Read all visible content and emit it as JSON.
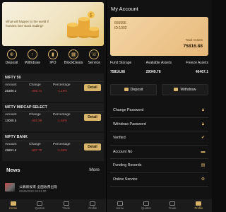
{
  "left": {
    "banner": {
      "text": "What will happen to the world if humans lose stock trading?"
    },
    "quick_links": [
      {
        "label": "Deposit",
        "icon": "deposit-icon"
      },
      {
        "label": "Withdraw",
        "icon": "withdraw-icon"
      },
      {
        "label": "IPO",
        "icon": "ipo-icon"
      },
      {
        "label": "BlockDeals",
        "icon": "block-deals-icon"
      },
      {
        "label": "Service",
        "icon": "service-icon"
      }
    ],
    "cards": [
      {
        "name": "NIFTY 50",
        "amount_label": "Amount",
        "change_label": "Change",
        "pct_label": "Percentage",
        "amount": "25390.2",
        "change": "-305.71",
        "pct": "-1.19%",
        "button": "Detail"
      },
      {
        "name": "NIFTY MIDCAP SELECT",
        "amount_label": "Amount",
        "change_label": "Change",
        "pct_label": "Percentage",
        "amount": "13000.5",
        "change": "-202.90",
        "pct": "-1.54%",
        "button": "Detail"
      },
      {
        "name": "NIFTY BANK",
        "amount_label": "Amount",
        "change_label": "Change",
        "pct_label": "Percentage",
        "amount": "49651.6",
        "change": "-807.70",
        "pct": "-1.60%",
        "button": "Detail"
      }
    ],
    "news": {
      "title": "News",
      "more": "More",
      "item_text": "公募新规来 全面收费出现",
      "item_date": "09/29/2022 09:01:00"
    }
  },
  "right": {
    "title": "My Account",
    "card": {
      "id_line1": "666666",
      "id_line2": "ID:1002",
      "total_label": "Total Assets",
      "total": "75816.88"
    },
    "stats": [
      {
        "label": "Fund Storage",
        "value": "75816.88"
      },
      {
        "label": "Available Assets",
        "value": "29349.78"
      },
      {
        "label": "Freeze Assets",
        "value": "46467.1"
      }
    ],
    "buttons": {
      "deposit": "Deposit",
      "withdraw": "Withdraw"
    },
    "menu": [
      {
        "label": "Change Password",
        "icon": "lock-icon"
      },
      {
        "label": "Withdraw Password",
        "icon": "lock-icon"
      },
      {
        "label": "Verified",
        "icon": "user-check-icon"
      },
      {
        "label": "Account No",
        "icon": "card-icon"
      },
      {
        "label": "Funding Records",
        "icon": "document-icon"
      },
      {
        "label": "Online Service",
        "icon": "gear-icon"
      }
    ]
  },
  "tabbar": [
    {
      "label": "Home"
    },
    {
      "label": "Quotes"
    },
    {
      "label": "Trade"
    },
    {
      "label": "Profile"
    }
  ],
  "colors": {
    "accent": "#d9b56b",
    "background": "#121212",
    "negative": "#d83c3c"
  }
}
